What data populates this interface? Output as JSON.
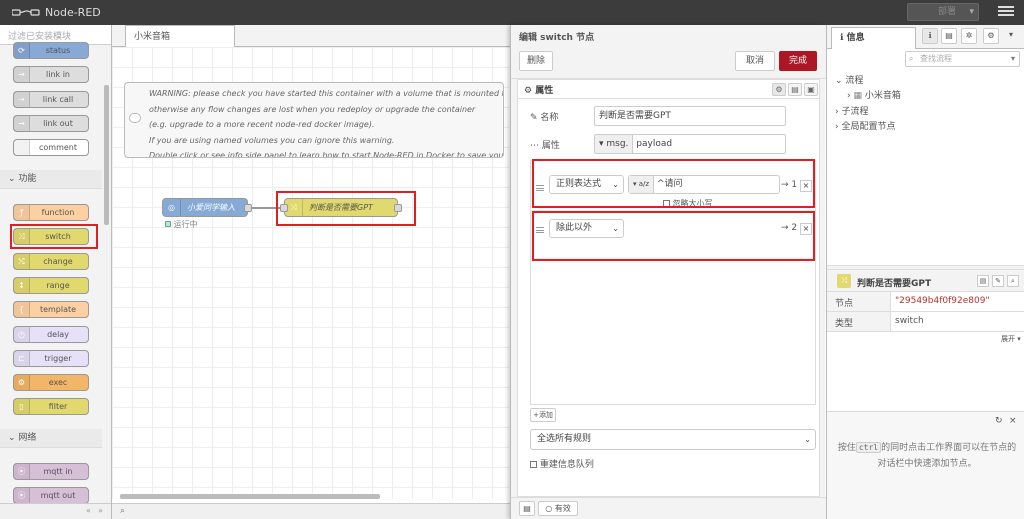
{
  "header": {
    "title": "Node-RED",
    "deploy_label": "部署"
  },
  "palette": {
    "search_placeholder": "过滤已安装模块",
    "nodes_top": [
      {
        "label": "status",
        "color": "#87a9d6",
        "icon": "⟳"
      },
      {
        "label": "link in",
        "color": "#dddddd",
        "icon": "→"
      },
      {
        "label": "link call",
        "color": "#dddddd",
        "icon": "⇢"
      },
      {
        "label": "link out",
        "color": "#dddddd",
        "icon": "→"
      },
      {
        "label": "comment",
        "color": "#ffffff",
        "icon": ""
      }
    ],
    "category_function": "功能",
    "nodes_function": [
      {
        "label": "function",
        "color": "#fdd0a2",
        "icon": "ƒ"
      },
      {
        "label": "switch",
        "color": "#e2d96e",
        "icon": "⤨"
      },
      {
        "label": "change",
        "color": "#e2d96e",
        "icon": "⤭"
      },
      {
        "label": "range",
        "color": "#e2d96e",
        "icon": "↕"
      },
      {
        "label": "template",
        "color": "#fdd0a2",
        "icon": "{"
      },
      {
        "label": "delay",
        "color": "#e6e0f8",
        "icon": "◷"
      },
      {
        "label": "trigger",
        "color": "#e6e0f8",
        "icon": "⊏"
      },
      {
        "label": "exec",
        "color": "#f3b567",
        "icon": "⚙"
      },
      {
        "label": "filter",
        "color": "#e2d96e",
        "icon": "▯"
      }
    ],
    "category_network": "网络",
    "nodes_network": [
      {
        "label": "mqtt in",
        "color": "#d8bfd8",
        "icon": "⦿"
      },
      {
        "label": "mqtt out",
        "color": "#d8bfd8",
        "icon": "⦿"
      }
    ]
  },
  "workspace": {
    "tab_label": "小米音箱",
    "comment_lines": [
      "WARNING: please check you have started this container with a volume that is mounted to /data",
      "otherwise any flow changes are lost when you redeploy or upgrade the container",
      "(e.g. upgrade to a more recent node-red docker image).",
      "If you are using named volumes you can ignore this warning.",
      "Double click or see info side panel to learn how to start Node-RED in Docker to save your work"
    ],
    "node1_label": "小爱同学输入",
    "node1_status": "运行中",
    "node2_label": "判断是否需要GPT"
  },
  "tray": {
    "title": "编辑 switch 节点",
    "delete_label": "删除",
    "cancel_label": "取消",
    "done_label": "完成",
    "tab_properties": "属性",
    "name_label": "名称",
    "name_value": "判断是否需要GPT",
    "property_label": "属性",
    "property_prefix": "msg.",
    "property_value": "payload",
    "rule1_operator": "正则表达式",
    "rule1_type_icon": "a/z",
    "rule1_value": "^请问",
    "rule1_ignore_case": "忽略大小写",
    "rule1_output": "→ 1",
    "rule2_operator": "除此以外",
    "rule2_output": "→ 2",
    "add_label": "添加",
    "check_all_label": "全选所有规则",
    "recreate_label": "重建信息队列",
    "enabled_label": "有效"
  },
  "sidebar": {
    "tab_info": "信息",
    "search_placeholder": "查找流程",
    "tree_flows": "流程",
    "tree_flow_item": "小米音箱",
    "tree_subflows": "子流程",
    "tree_global": "全局配置节点",
    "node_title": "判断是否需要GPT",
    "row_node_key": "节点",
    "row_node_value": "\"29549b4f0f92e809\"",
    "row_type_key": "类型",
    "row_type_value": "switch",
    "expand_label": "展开 ▾",
    "tip_pre": "按住",
    "tip_key": "ctrl",
    "tip_post": "的同时点击工作界面可以在节点的对话栏中快速添加节点。"
  }
}
